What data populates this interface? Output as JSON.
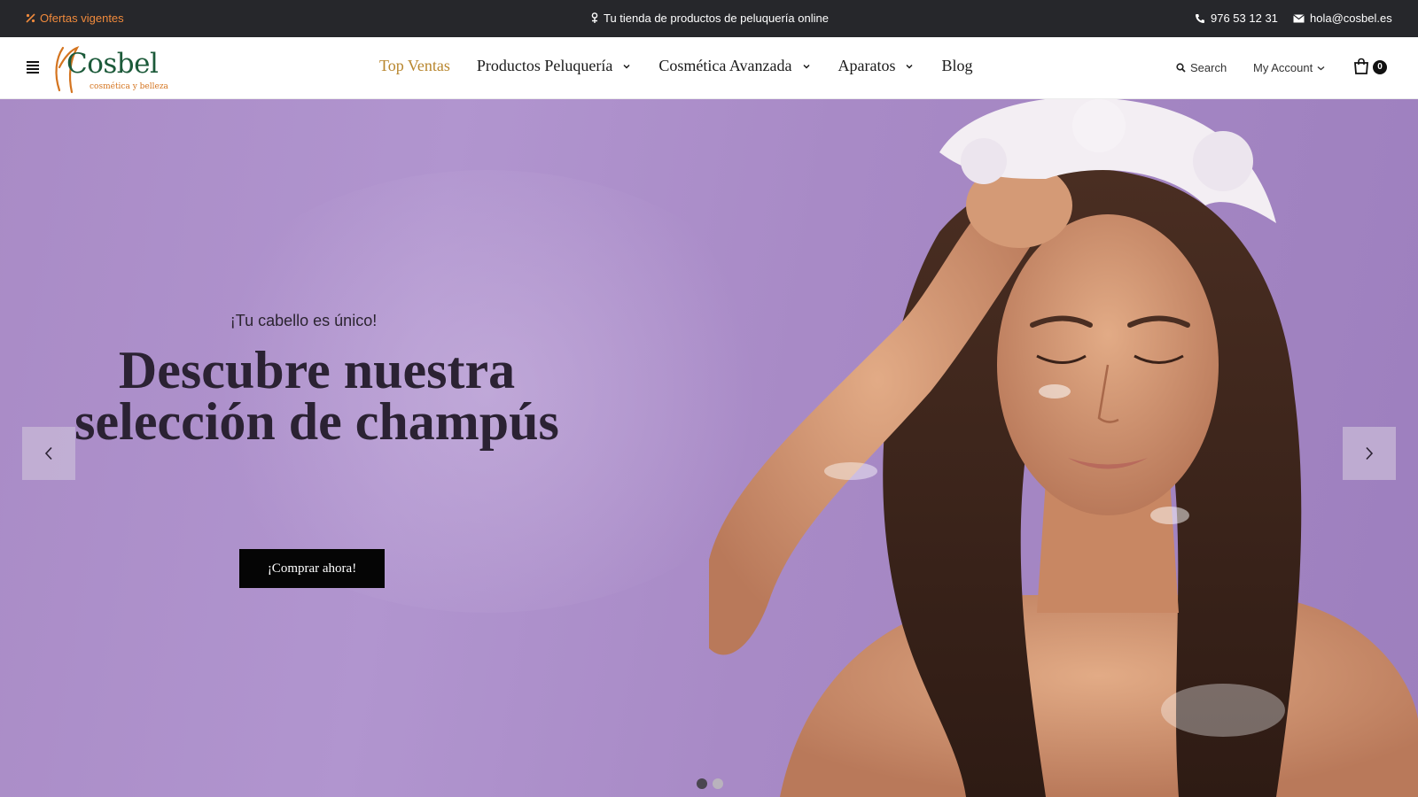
{
  "topbar": {
    "offers": "Ofertas vigentes",
    "tagline": "Tu tienda de productos de peluquería online",
    "phone": "976 53 12 31",
    "email": "hola@cosbel.es"
  },
  "logo": {
    "name": "Cosbel",
    "tagline": "cosmética y belleza"
  },
  "nav": {
    "items": [
      {
        "label": "Top Ventas",
        "dropdown": false,
        "active": true
      },
      {
        "label": "Productos Peluquería",
        "dropdown": true
      },
      {
        "label": "Cosmética Avanzada",
        "dropdown": true
      },
      {
        "label": "Aparatos",
        "dropdown": true
      },
      {
        "label": "Blog",
        "dropdown": false
      }
    ]
  },
  "header": {
    "search_label": "Search",
    "account_label": "My Account",
    "cart_count": "0"
  },
  "hero": {
    "eyebrow": "¡Tu cabello es único!",
    "headline_line1": "Descubre nuestra",
    "headline_line2": "selección de champús",
    "cta_label": "¡Comprar ahora!",
    "slide_count": 2,
    "active_slide": 1
  },
  "colors": {
    "topbar_bg": "#26272b",
    "offers_accent": "#f08a3c",
    "nav_active": "#b8862e",
    "hero_bg": "#a98bc6",
    "cta_bg": "#050505"
  }
}
